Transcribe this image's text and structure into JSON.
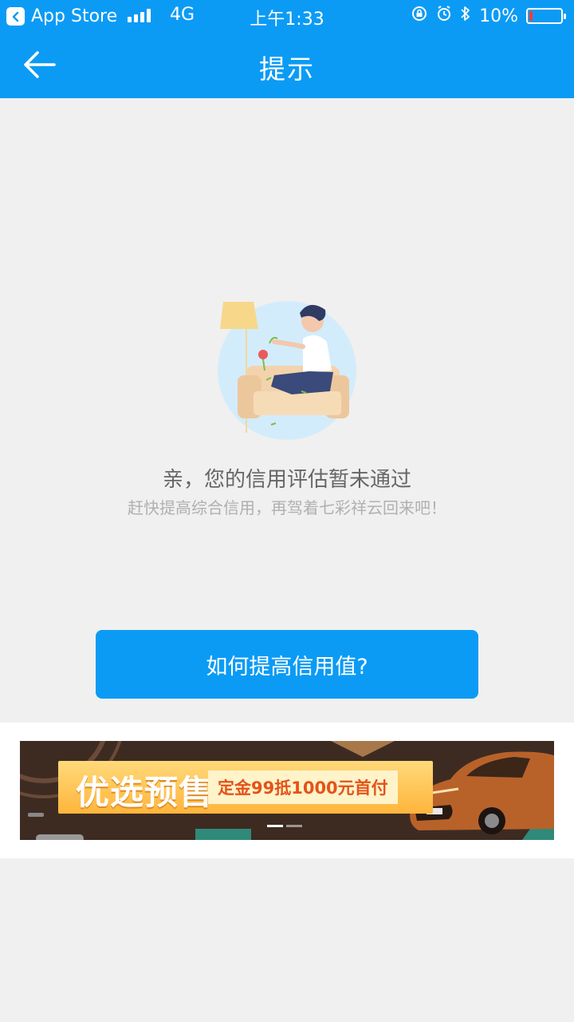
{
  "statusbar": {
    "back_app": "App Store",
    "network": "4G",
    "time": "上午1:33",
    "battery": "10%",
    "battery_level": 0.1
  },
  "navbar": {
    "title": "提示"
  },
  "message": {
    "title": "亲，您的信用评估暂未通过",
    "subtitle": "赶快提高综合信用，再驾着七彩祥云回来吧！"
  },
  "cta": {
    "label": "如何提高信用值?"
  },
  "banner": {
    "headline": "优选预售",
    "deal": "定金99抵1000元首付",
    "slides_total": 2,
    "slide_active": 1
  },
  "colors": {
    "accent": "#0b9bf5",
    "background": "#f0f0f0"
  }
}
